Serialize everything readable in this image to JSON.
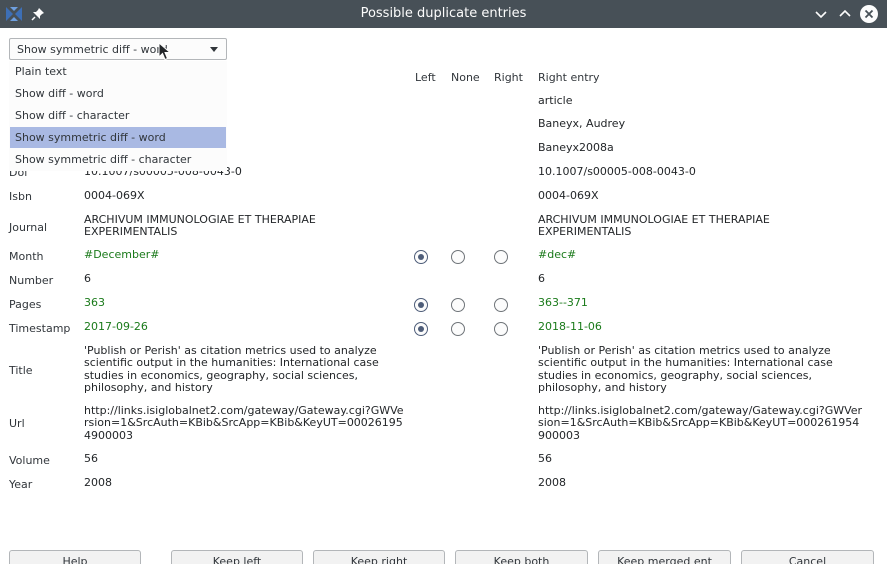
{
  "window": {
    "title": "Possible duplicate entries"
  },
  "diff_mode": {
    "selected": "Show symmetric diff - word",
    "options": [
      "Plain text",
      "Show diff - word",
      "Show diff - character",
      "Show symmetric diff - word",
      "Show symmetric diff - character"
    ]
  },
  "headers": {
    "left": "Left",
    "none": "None",
    "right": "Right",
    "right_entry": "Right entry"
  },
  "right_only": {
    "type": "article",
    "author": "Baneyx, Audrey",
    "key": "Baneyx2008a"
  },
  "fields": {
    "doi": {
      "label": "Doi",
      "left": "10.1007/s00005-008-0043-0",
      "right": "10.1007/s00005-008-0043-0"
    },
    "isbn": {
      "label": "Isbn",
      "left": "0004-069X",
      "right": "0004-069X"
    },
    "journal": {
      "label": "Journal",
      "left": "ARCHIVUM IMMUNOLOGIAE ET THERAPIAE\nEXPERIMENTALIS",
      "right": "ARCHIVUM IMMUNOLOGIAE ET THERAPIAE\nEXPERIMENTALIS"
    },
    "month": {
      "label": "Month",
      "left": "#December#",
      "right": "#dec#",
      "choice": "left"
    },
    "number": {
      "label": "Number",
      "left": "6",
      "right": "6"
    },
    "pages": {
      "label": "Pages",
      "left": "363",
      "right": "363--371",
      "choice": "left"
    },
    "timestamp": {
      "label": "Timestamp",
      "left": "2017-09-26",
      "right": "2018-11-06",
      "choice": "left"
    },
    "title": {
      "label": "Title",
      "left": "'Publish or Perish' as citation metrics used to analyze\nscientific output in the humanities: International case\nstudies in economics, geography, social sciences,\nphilosophy, and history",
      "right": "'Publish or Perish' as citation metrics used to analyze\nscientific output in the humanities: International case\nstudies in economics, geography, social sciences,\nphilosophy, and history"
    },
    "url": {
      "label": "Url",
      "left": "http://links.isiglobalnet2.com/gateway/Gateway.cgi?GWVe\nrsion=1&SrcAuth=KBib&SrcApp=KBib&KeyUT=00026195\n4900003",
      "right": "http://links.isiglobalnet2.com/gateway/Gateway.cgi?GWVer\nsion=1&SrcAuth=KBib&SrcApp=KBib&KeyUT=000261954\n900003"
    },
    "volume": {
      "label": "Volume",
      "left": "56",
      "right": "56"
    },
    "year": {
      "label": "Year",
      "left": "2008",
      "right": "2008"
    }
  },
  "buttons": {
    "help": "Help",
    "keep_left": "Keep left",
    "keep_right": "Keep right",
    "keep_both": "Keep both",
    "keep_merged": "Keep merged ent",
    "cancel": "Cancel"
  },
  "colors": {
    "titlebar": "#475057",
    "selection": "#a9b9e3",
    "diff_text": "#1a7a1a"
  }
}
